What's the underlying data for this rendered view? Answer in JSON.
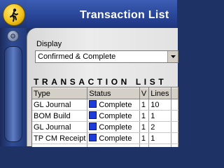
{
  "window": {
    "title": "Transaction List"
  },
  "filter": {
    "label": "Display",
    "value": "Confirmed & Complete"
  },
  "list": {
    "heading": "TRANSACTION LIST",
    "columns": [
      "Type",
      "Status",
      "V",
      "Lines",
      ""
    ],
    "rows": [
      {
        "type": "GL Journal",
        "status": "Complete",
        "v": "1",
        "lines": "10"
      },
      {
        "type": "BOM Build",
        "status": "Complete",
        "v": "1",
        "lines": "1"
      },
      {
        "type": "GL Journal",
        "status": "Complete",
        "v": "1",
        "lines": "2"
      },
      {
        "type": "TP CM Receipt",
        "status": "Complete",
        "v": "1",
        "lines": "1"
      },
      {
        "type": "",
        "status": "",
        "v": "",
        "lines": ""
      }
    ]
  },
  "colors": {
    "status_complete": "#1e3cd8",
    "title_bar": "#2a4698",
    "app_icon": "#f2c218"
  },
  "icons": {
    "app": "walking-figure-icon",
    "rail": "gear-icon",
    "dropdown": "chevron-down-icon"
  }
}
